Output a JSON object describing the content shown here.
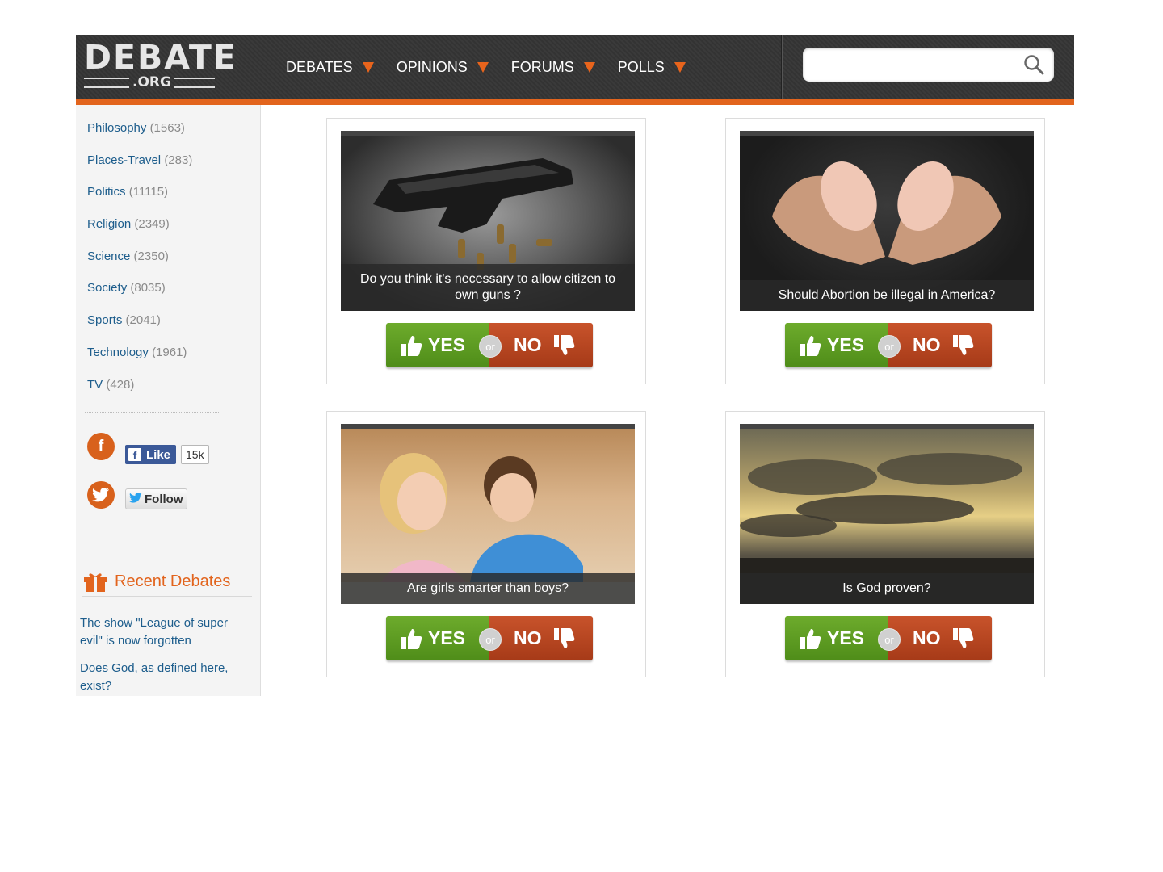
{
  "logo": {
    "main": "DEBATE",
    "sub": ".ORG"
  },
  "nav": [
    {
      "label": "DEBATES"
    },
    {
      "label": "OPINIONS"
    },
    {
      "label": "FORUMS"
    },
    {
      "label": "POLLS"
    }
  ],
  "search": {
    "value": "",
    "placeholder": "",
    "icon": "search-icon"
  },
  "categories": [
    {
      "name": "Philosophy",
      "count": "(1563)"
    },
    {
      "name": "Places-Travel",
      "count": "(283)"
    },
    {
      "name": "Politics",
      "count": "(11115)"
    },
    {
      "name": "Religion",
      "count": "(2349)"
    },
    {
      "name": "Science",
      "count": "(2350)"
    },
    {
      "name": "Society",
      "count": "(8035)"
    },
    {
      "name": "Sports",
      "count": "(2041)"
    },
    {
      "name": "Technology",
      "count": "(1961)"
    },
    {
      "name": "TV",
      "count": "(428)"
    }
  ],
  "social": {
    "facebook_icon": "f",
    "like_label": "Like",
    "like_count": "15k",
    "follow_label": "Follow"
  },
  "recent": {
    "title": "Recent Debates",
    "items": [
      "The show \"League of super evil\" is now forgotten",
      "Does God, as defined here, exist?"
    ]
  },
  "polls": [
    {
      "caption": "Do you think it's necessary to allow citizen to own guns ?",
      "image": "handgun-photo"
    },
    {
      "caption": "Should Abortion be illegal in America?",
      "image": "baby-feet-photo"
    },
    {
      "caption": "Are girls smarter than boys?",
      "image": "children-photo"
    },
    {
      "caption": "Is God proven?",
      "image": "sky-photo"
    }
  ],
  "vote": {
    "yes": "YES",
    "or": "or",
    "no": "NO"
  },
  "colors": {
    "accent": "#e2641d",
    "link": "#1d5d8c",
    "yes": "#5c9a21",
    "no": "#b84520",
    "header": "#363636"
  }
}
